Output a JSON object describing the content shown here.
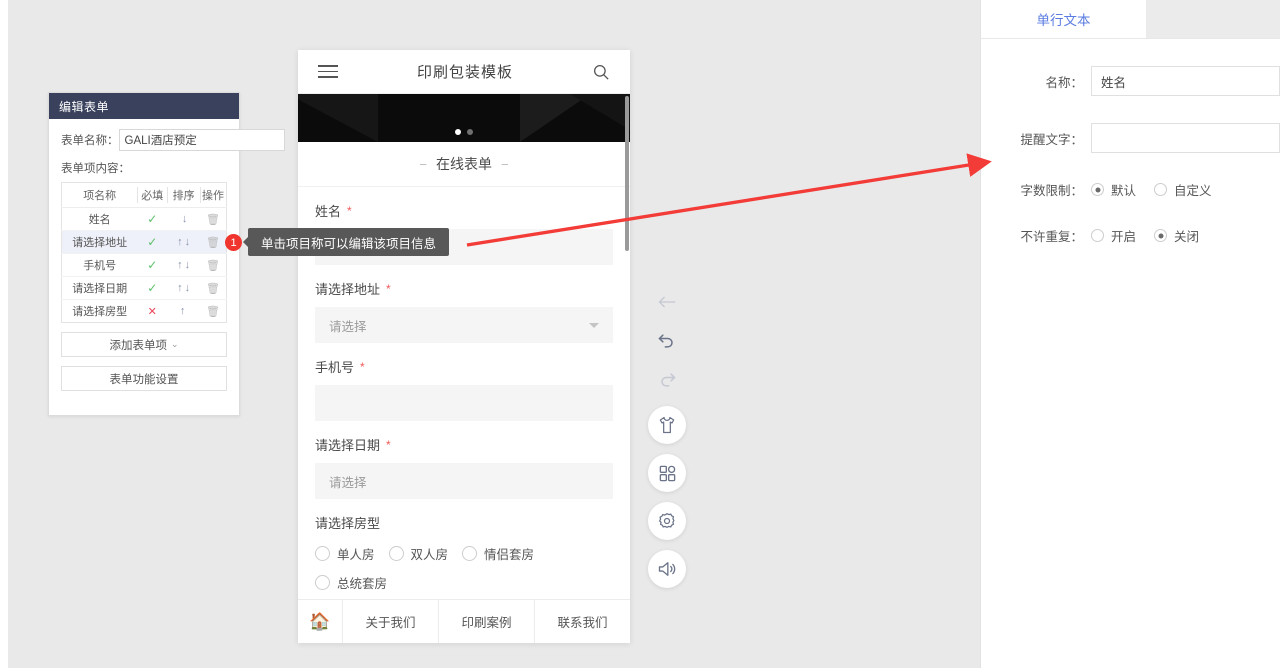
{
  "edit_panel": {
    "header_title": "编辑表单",
    "form_name_label": "表单名称：",
    "form_name_value": "GALI酒店预定",
    "items_label": "表单项内容：",
    "table": {
      "headers": [
        "项名称",
        "必填",
        "排序",
        "操作"
      ],
      "rows": [
        {
          "name": "姓名",
          "required": "✓",
          "required_state": "yes",
          "up": "",
          "down": "↓",
          "delete_icon": "trash-icon",
          "highlight": false
        },
        {
          "name": "请选择地址",
          "required": "✓",
          "required_state": "yes",
          "up": "↑",
          "down": "↓",
          "delete_icon": "trash-icon",
          "highlight": true
        },
        {
          "name": "手机号",
          "required": "✓",
          "required_state": "yes",
          "up": "↑",
          "down": "↓",
          "delete_icon": "trash-icon",
          "highlight": false
        },
        {
          "name": "请选择日期",
          "required": "✓",
          "required_state": "yes",
          "up": "↑",
          "down": "↓",
          "delete_icon": "trash-icon",
          "highlight": false
        },
        {
          "name": "请选择房型",
          "required": "✕",
          "required_state": "no",
          "up": "↑",
          "down": "",
          "delete_icon": "trash-icon",
          "highlight": false
        }
      ]
    },
    "add_item_button": "添加表单项",
    "settings_button": "表单功能设置"
  },
  "callout": {
    "badge": "1",
    "text": "单击项目称可以编辑该项目信息",
    "badge_color": "#f0342e",
    "bubble_color": "#585858"
  },
  "phone": {
    "title": "印刷包装模板",
    "menu_icon": "hamburger-icon",
    "search_icon": "search-icon",
    "carousel": {
      "dots": 2,
      "active_index": 0
    },
    "section_title": "在线表单",
    "section_dash": "−",
    "fields": [
      {
        "label": "姓名",
        "required": true,
        "type": "text",
        "value": ""
      },
      {
        "label": "请选择地址",
        "required": true,
        "type": "select",
        "placeholder": "请选择"
      },
      {
        "label": "手机号",
        "required": true,
        "type": "text",
        "value": ""
      },
      {
        "label": "请选择日期",
        "required": true,
        "type": "date",
        "placeholder": "请选择"
      }
    ],
    "radio_field": {
      "label": "请选择房型",
      "required": false,
      "options": [
        "单人房",
        "双人房",
        "情侣套房",
        "总统套房"
      ]
    },
    "bottom_nav": {
      "home_icon": "home-icon",
      "items": [
        "关于我们",
        "印刷案例",
        "联系我们"
      ]
    }
  },
  "toolbar": {
    "items": [
      {
        "icon": "back-arrow-icon",
        "style": "plain",
        "muted": true
      },
      {
        "icon": "undo-icon",
        "style": "plain",
        "muted": false
      },
      {
        "icon": "redo-icon",
        "style": "plain",
        "muted": true
      },
      {
        "icon": "tshirt-icon",
        "style": "round",
        "muted": false
      },
      {
        "icon": "grid-apps-icon",
        "style": "round",
        "muted": false
      },
      {
        "icon": "gear-icon",
        "style": "round",
        "muted": false
      },
      {
        "icon": "speaker-icon",
        "style": "round",
        "muted": false
      }
    ]
  },
  "right_panel": {
    "active_tab": "单行文本",
    "accent_color": "#5b7ce0",
    "name_label": "名称：",
    "name_value": "姓名",
    "placeholder_label": "提醒文字：",
    "placeholder_value": "",
    "limit_label": "字数限制：",
    "limit_options": [
      {
        "label": "默认",
        "selected": true
      },
      {
        "label": "自定义",
        "selected": false
      }
    ],
    "unique_label": "不许重复：",
    "unique_options": [
      {
        "label": "开启",
        "selected": false
      },
      {
        "label": "关闭",
        "selected": true
      }
    ]
  },
  "annotation_arrow": {
    "color": "#f33b37"
  }
}
